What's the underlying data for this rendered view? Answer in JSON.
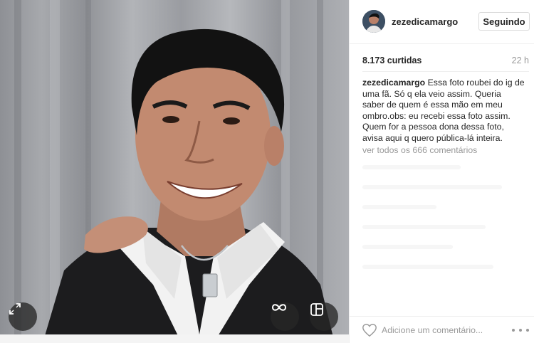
{
  "post": {
    "username": "zezedicamargo",
    "follow_label": "Seguindo",
    "likes": "8.173 curtidas",
    "time_ago": "22 h",
    "caption_user": "zezedicamargo",
    "caption_text": "Essa foto roubei do ig de uma fã. Só q ela veio assim. Queria saber de quem é essa mão em meu ombro.obs: eu recebi essa foto assim. Quem for a pessoa dona dessa foto, avisa aqui q quero pública-lá inteira.",
    "view_all_comments": "ver todos os 666 comentários",
    "comment_placeholder": "Adicione um comentário..."
  },
  "icons": {
    "expand": "expand-icon",
    "boomerang": "infinity-icon",
    "layout": "layout-icon",
    "like": "heart-icon",
    "more": "more-options-icon"
  },
  "colors": {
    "text": "#262626",
    "muted": "#999999",
    "border": "#dbdbdb",
    "control_bg": "#262626"
  }
}
